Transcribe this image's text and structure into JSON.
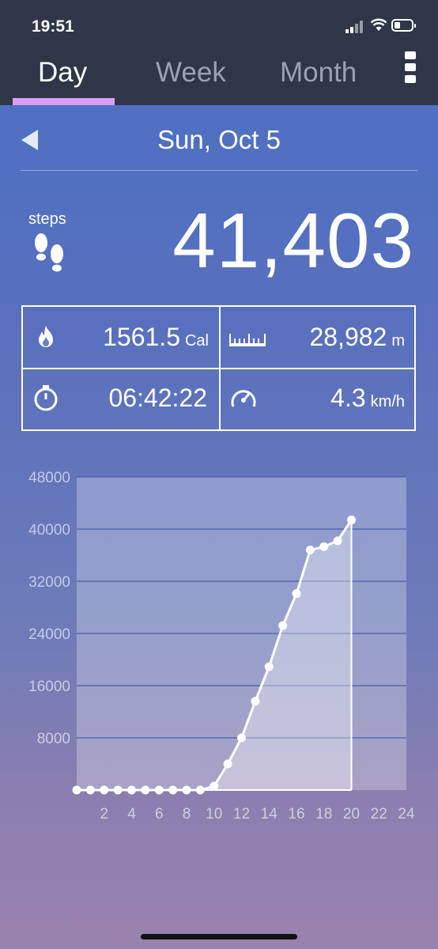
{
  "status": {
    "time": "19:51"
  },
  "tabs": [
    {
      "label": "Day",
      "active": true
    },
    {
      "label": "Week",
      "active": false
    },
    {
      "label": "Month",
      "active": false
    }
  ],
  "date": "Sun, Oct 5",
  "steps": {
    "label": "steps",
    "value": "41,403"
  },
  "stats": {
    "calories": {
      "value": "1561.5",
      "unit": "Cal",
      "icon": "flame-icon"
    },
    "distance": {
      "value": "28,982",
      "unit": "m",
      "icon": "ruler-icon"
    },
    "duration": {
      "value": "06:42:22",
      "icon": "stopwatch-icon"
    },
    "speed": {
      "value": "4.3",
      "unit": "km/h",
      "icon": "speedometer-icon"
    }
  },
  "colors": {
    "topbar": "#2e3648",
    "tab_underline": "#d79ff2",
    "inactive_tab": "#9aa2b2"
  },
  "chart_data": {
    "type": "area",
    "title": "",
    "xlabel": "",
    "ylabel": "",
    "xlim": [
      0,
      24
    ],
    "ylim": [
      0,
      48000
    ],
    "yticks": [
      8000,
      16000,
      24000,
      32000,
      40000,
      48000
    ],
    "xticks": [
      2,
      4,
      6,
      8,
      10,
      12,
      14,
      16,
      18,
      20,
      22,
      24
    ],
    "grid": true,
    "series": [
      {
        "x": [
          0,
          1,
          2,
          3,
          4,
          5,
          6,
          7,
          8,
          9,
          10,
          11,
          12,
          13,
          14,
          15,
          16,
          17,
          18,
          19,
          20
        ],
        "values": [
          0,
          0,
          0,
          0,
          0,
          0,
          0,
          0,
          0,
          0,
          600,
          4000,
          8000,
          13600,
          18900,
          25200,
          30100,
          36800,
          37300,
          38200,
          41403
        ]
      }
    ]
  }
}
